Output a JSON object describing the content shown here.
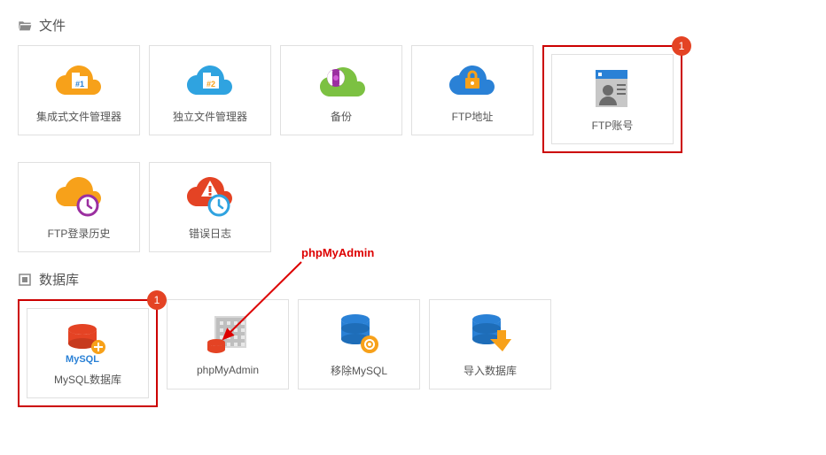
{
  "sections": {
    "files": {
      "title": "文件",
      "items": [
        {
          "label": "集成式文件管理器"
        },
        {
          "label": "独立文件管理器"
        },
        {
          "label": "备份"
        },
        {
          "label": "FTP地址"
        },
        {
          "label": "FTP账号",
          "badge": "1",
          "highlighted": true
        },
        {
          "label": "FTP登录历史"
        },
        {
          "label": "错误日志"
        }
      ]
    },
    "database": {
      "title": "数据库",
      "items": [
        {
          "label": "MySQL数据库",
          "badge": "1",
          "highlighted": true
        },
        {
          "label": "phpMyAdmin"
        },
        {
          "label": "移除MySQL"
        },
        {
          "label": "导入数据库"
        }
      ]
    }
  },
  "annotation": {
    "label": "phpMyAdmin"
  }
}
